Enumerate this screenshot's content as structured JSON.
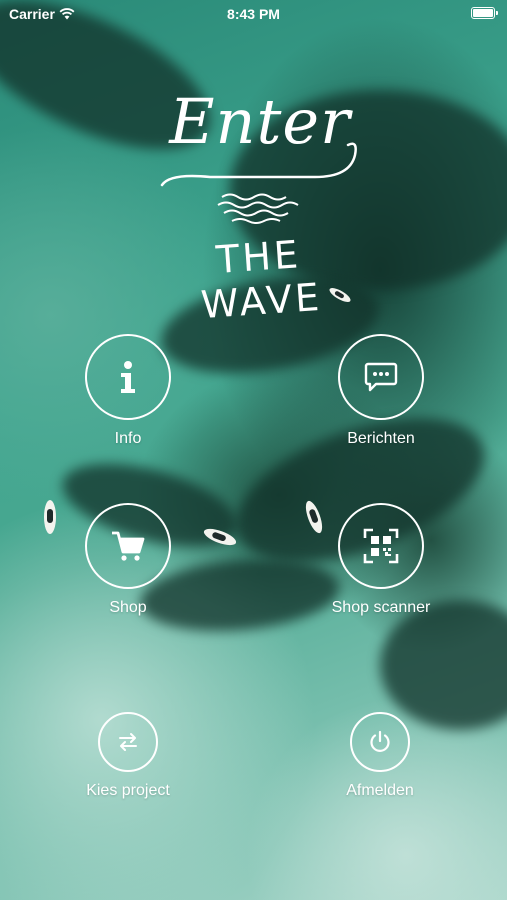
{
  "status_bar": {
    "carrier": "Carrier",
    "time": "8:43 PM"
  },
  "logo": {
    "word": "Enter",
    "sub": "THE WAVE"
  },
  "menu": {
    "info": {
      "label": "Info",
      "icon": "info-icon"
    },
    "messages": {
      "label": "Berichten",
      "icon": "chat-icon"
    },
    "shop": {
      "label": "Shop",
      "icon": "cart-icon"
    },
    "shop_scanner": {
      "label": "Shop scanner",
      "icon": "qr-scan-icon"
    },
    "choose_project": {
      "label": "Kies project",
      "icon": "swap-arrows-icon"
    },
    "logout": {
      "label": "Afmelden",
      "icon": "power-icon"
    }
  },
  "colors": {
    "water": "#2c8a78",
    "foreground": "#ffffff"
  }
}
